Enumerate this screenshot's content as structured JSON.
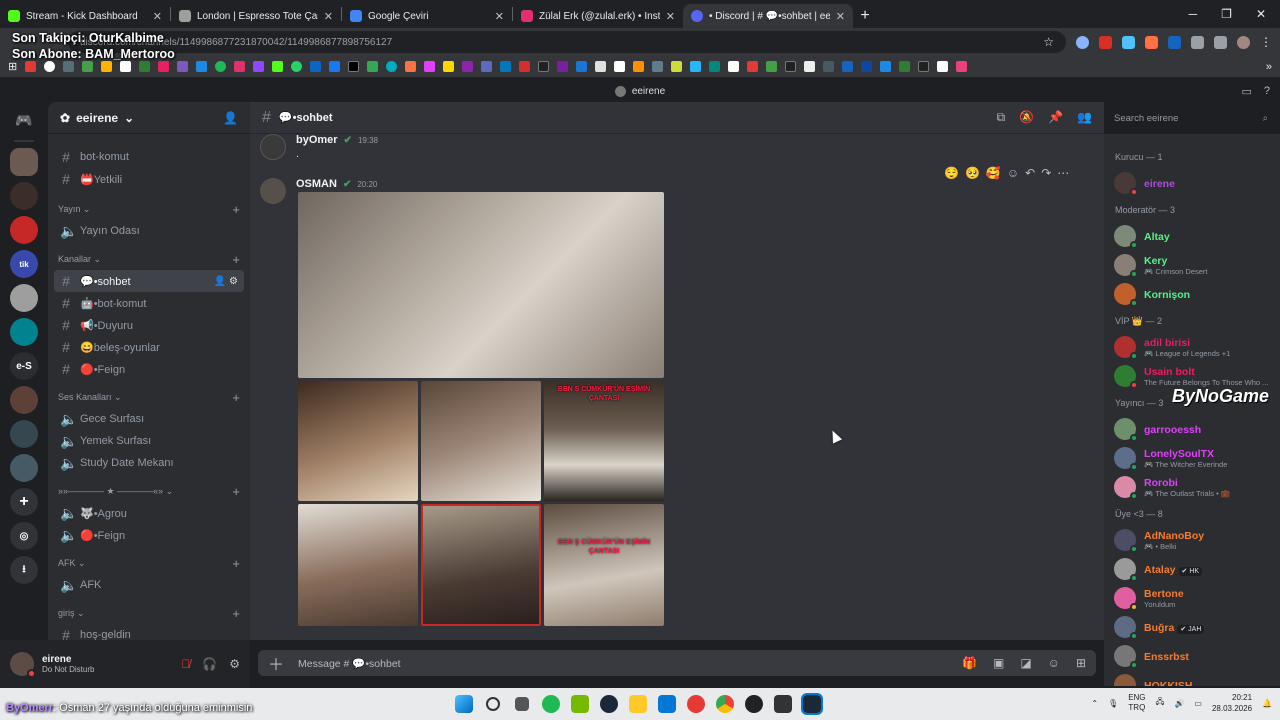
{
  "overlay": {
    "line1": "Son Takipçi: OturKalbime",
    "line2": "Son Abone: BAM_Mertoroo"
  },
  "browser": {
    "tabs": [
      {
        "title": "Stream - Kick Dashboard",
        "color": "#53fc18"
      },
      {
        "title": "London | Espresso Tote Çanta M",
        "color": "#9e9e9e"
      },
      {
        "title": "Google Çeviri",
        "color": "#4285f4"
      },
      {
        "title": "Zülal Erk (@zulal.erk) • Instagra",
        "color": "#e1306c"
      },
      {
        "title": "• Discord | # 💬•sohbet | eeiren",
        "color": "#5865f2"
      }
    ],
    "url": "discord.com/channels/1149986877231870042/1149986877898756127"
  },
  "discord": {
    "window_title": "eeirene",
    "server_name": "eeirene",
    "channels": {
      "top": [
        {
          "label": "bot-komut"
        },
        {
          "label": "📛Yetkili"
        }
      ],
      "yayin_cat": "Yayın",
      "yayin": [
        {
          "label": "Yayın Odası"
        }
      ],
      "kanallar_cat": "Kanallar",
      "kanallar": [
        {
          "label": "💬•sohbet"
        },
        {
          "label": "🤖•bot-komut"
        },
        {
          "label": "📢•Duyuru"
        },
        {
          "label": "😄beleş-oyunlar"
        },
        {
          "label": "🔴•Feign"
        }
      ],
      "ses_cat": "Ses Kanalları",
      "ses": [
        {
          "label": "Gece Surfası"
        },
        {
          "label": "Yemek Surfası"
        },
        {
          "label": "Study Date Mekanı"
        }
      ],
      "star_cat": "»»———— ★ ————«»",
      "star": [
        {
          "label": "🐺•Agrou"
        },
        {
          "label": "🔴•Feign"
        }
      ],
      "afk_cat": "AFK",
      "afk": [
        {
          "label": "AFK"
        }
      ],
      "giris_cat": "giriş",
      "giris": [
        {
          "label": "hoş-geldin"
        }
      ]
    },
    "user": {
      "name": "eirene",
      "status": "Do Not Disturb"
    },
    "chat": {
      "channel": "💬•sohbet",
      "search_placeholder": "Search eeirene",
      "input_placeholder": "Message # 💬•sohbet",
      "messages": [
        {
          "author": "byOmer",
          "time": "19:38",
          "text": "."
        },
        {
          "author": "OSMAN",
          "time": "20:20",
          "text": ""
        }
      ],
      "image_captions": [
        "BEN Ş CÜMKÜR'ÜN EŞİMİN ÇANTASI",
        "BEN Ş CÜMKÜR'ÜN EŞİMİN ÇANTASI"
      ]
    },
    "members": {
      "groups": [
        {
          "title": "Kurucu — 1",
          "members": [
            {
              "name": "eirene",
              "sub": "",
              "color": "#b04bd8",
              "status": "#f23f43",
              "av": "#4a3a36"
            }
          ]
        },
        {
          "title": "Moderatör — 3",
          "members": [
            {
              "name": "Altay",
              "sub": "",
              "color": "#57f287",
              "status": "#23a559",
              "av": "#7d8a7a"
            },
            {
              "name": "Kery",
              "sub": "🎮 Crimson Desert",
              "color": "#57f287",
              "status": "#23a559",
              "av": "#8a7f76"
            },
            {
              "name": "Kornişon",
              "sub": "",
              "color": "#57f287",
              "status": "#23a559",
              "av": "#c0602a"
            }
          ]
        },
        {
          "title": "VİP 👑 — 2",
          "members": [
            {
              "name": "adil birisi",
              "sub": "🎮 League of Legends +1",
              "color": "#e91e63",
              "status": "#23a559",
              "av": "#b03030"
            },
            {
              "name": "Usain bolt",
              "sub": "The Future Belongs To Those Who ...",
              "color": "#e91e63",
              "status": "#f23f43",
              "av": "#2e7d32"
            }
          ]
        },
        {
          "title": "Yayıncı — 3",
          "members": [
            {
              "name": "garrooessh",
              "sub": "",
              "color": "#e040fb",
              "status": "#23a559",
              "av": "#6d8f6a"
            },
            {
              "name": "LonelySoulTX",
              "sub": "🎮 The Witcher Everinde",
              "color": "#e040fb",
              "status": "#23a559",
              "av": "#5c6e8a"
            },
            {
              "name": "Rorobi",
              "sub": "🎮 The Outlast Trials • 💼",
              "color": "#e040fb",
              "status": "#23a559",
              "av": "#d98aa8"
            }
          ]
        },
        {
          "title": "Üye <3 — 8",
          "members": [
            {
              "name": "AdNanoBoy",
              "sub": "🎮 • Belki",
              "color": "#f57c32",
              "status": "#23a559",
              "av": "#4d4d66"
            },
            {
              "name": "Atalay",
              "sub": "",
              "color": "#f57c32",
              "status": "#23a559",
              "av": "#9a9a9a",
              "tag": "✔ HK"
            },
            {
              "name": "Bertone",
              "sub": "Yoruldum",
              "color": "#f57c32",
              "status": "#f0b232",
              "av": "#e05fa0"
            },
            {
              "name": "Buğra",
              "sub": "",
              "color": "#f57c32",
              "status": "#23a559",
              "av": "#5d6b85",
              "tag": "✔ JAH"
            },
            {
              "name": "Enssrbst",
              "sub": "",
              "color": "#f57c32",
              "status": "#23a559",
              "av": "#777"
            },
            {
              "name": "HOKKISH",
              "sub": "",
              "color": "#f57c32",
              "status": "#23a559",
              "av": "#8a5a3a"
            }
          ]
        }
      ]
    },
    "sponsor": "ByNoGame"
  },
  "ticker": {
    "user": "ByOmerr",
    "text": ": Osman 27 yaşında olduğuna eminmisin"
  },
  "taskbar": {
    "lang1": "ENG",
    "lang2": "TRQ",
    "time": "20:21",
    "date": "28.03.2026"
  }
}
